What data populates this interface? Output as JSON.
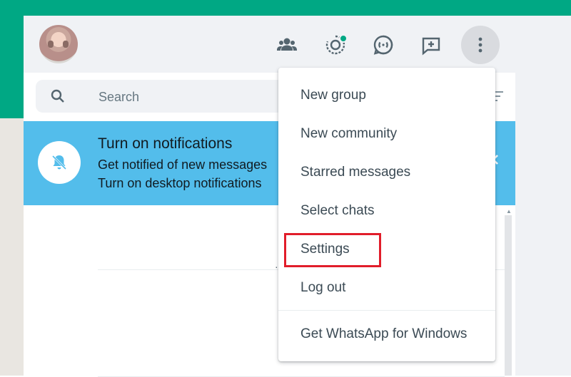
{
  "search": {
    "placeholder": "Search"
  },
  "header": {
    "icons": [
      "communities-icon",
      "status-icon",
      "channels-icon",
      "new-chat-icon",
      "menu-icon"
    ]
  },
  "notification": {
    "title": "Turn on notifications",
    "line1": "Get notified of new messages",
    "line2": "Turn on desktop notifications"
  },
  "menu": {
    "items": [
      {
        "label": "New group"
      },
      {
        "label": "New community"
      },
      {
        "label": "Starred messages"
      },
      {
        "label": "Select chats"
      },
      {
        "label": "Settings"
      },
      {
        "label": "Log out"
      },
      {
        "label": "Get WhatsApp for Windows"
      }
    ],
    "highlighted": "Settings"
  },
  "colors": {
    "brand_green": "#00a884",
    "header_bg": "#f0f2f5",
    "notification_bg": "#53bdeb",
    "highlight_red": "#e11d2a"
  }
}
